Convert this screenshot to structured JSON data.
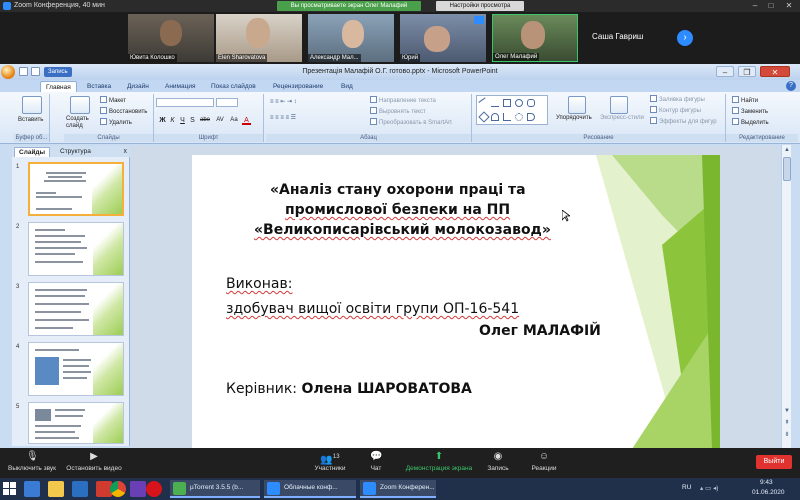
{
  "zoom": {
    "window_title": "Zoom Конференция, 40 мин",
    "share_banner": "Вы просматриваете экран Олег Малафий",
    "view_settings": "Настройки просмотра",
    "participants": [
      {
        "name": "Ювита Колошко"
      },
      {
        "name": "Elen Sharovatova"
      },
      {
        "name": "Александр Мал..."
      },
      {
        "name": "Юрий"
      },
      {
        "name": "Олег Малафий"
      },
      {
        "name": "Саша Гавриш"
      }
    ],
    "toolbar": {
      "mute": "Выключить звук",
      "video": "Остановить видео",
      "participants": "Участники",
      "participants_count": "13",
      "chat": "Чат",
      "share": "Демонстрация экрана",
      "record": "Запись",
      "reactions": "Реакции",
      "end": "Выйти"
    }
  },
  "ppt": {
    "window_title": "Презентація Малафій О.Г. готово.pptx - Microsoft PowerPoint",
    "qat_tooltip": "Запись",
    "tabs": [
      "Главная",
      "Вставка",
      "Дизайн",
      "Анимация",
      "Показ слайдов",
      "Рецензирование",
      "Вид"
    ],
    "active_tab": "Главная",
    "ribbon": {
      "clipboard": {
        "paste": "Вставить",
        "label": "Буфер об..."
      },
      "slides": {
        "create": "Создать слайд",
        "layout": "Макет",
        "reset": "Восстановить",
        "delete": "Удалить",
        "label": "Слайды"
      },
      "font": {
        "label": "Шрифт",
        "buttons": [
          "Ж",
          "К",
          "Ч",
          "S",
          "abe",
          "AV",
          "Аа",
          "A"
        ]
      },
      "paragraph": {
        "direction": "Направление текста",
        "align": "Выровнять текст",
        "smartart": "Преобразовать в SmartArt",
        "label": "Абзац"
      },
      "drawing": {
        "arrange": "Упорядочить",
        "quick_styles": "Экспресс-стили",
        "fill": "Заливка фигуры",
        "outline": "Контур фигуры",
        "effects": "Эффекты для фигур",
        "label": "Рисование"
      },
      "editing": {
        "find": "Найти",
        "replace": "Заменить",
        "select": "Выделить",
        "label": "Редактирование"
      }
    },
    "pane": {
      "tab_slides": "Слайды",
      "tab_outline": "Структура",
      "close": "x",
      "thumbs": [
        "1",
        "2",
        "3",
        "4",
        "5"
      ]
    },
    "slide": {
      "title_line1": "«Аналіз стану охорони праці та",
      "title_line2": "промислової безпеки на ПП",
      "title_line3": "«Великописарівський молокозавод»",
      "performed_label": "Виконав:",
      "student_line": "здобувач вищої освіти групи ОП-16-541",
      "student_name": "Олег МАЛАФІЙ",
      "supervisor_label": "Керівник:",
      "supervisor_name": "Олена ШАРОВАТОВА"
    }
  },
  "taskbar": {
    "tasks": [
      "µTorrent 3.5.5 (b...",
      "Облачные конф...",
      "Zoom Конферен..."
    ],
    "lang": "RU",
    "time": "9:43",
    "date": "01.06.2020"
  }
}
